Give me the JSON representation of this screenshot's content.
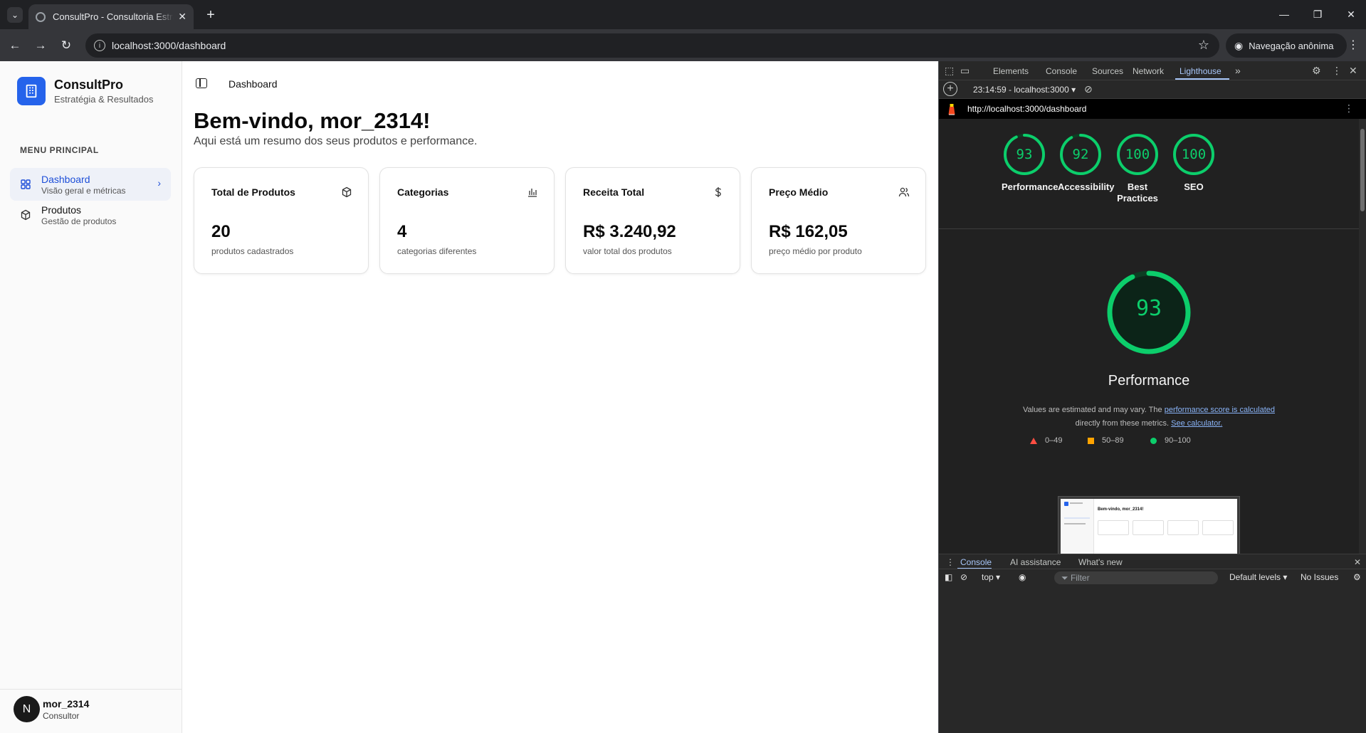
{
  "browser": {
    "tab_title": "ConsultPro - Consultoria Estratégica",
    "url": "localhost:3000/dashboard",
    "incognito_label": "Navegação anônima"
  },
  "sidebar": {
    "brand_name": "ConsultPro",
    "brand_subtitle": "Estratégia & Resultados",
    "menu_label": "MENU PRINCIPAL",
    "items": [
      {
        "title": "Dashboard",
        "subtitle": "Visão geral e métricas",
        "active": true
      },
      {
        "title": "Produtos",
        "subtitle": "Gestão de produtos",
        "active": false
      }
    ],
    "user": {
      "initial": "N",
      "name": "mor_2314",
      "role": "Consultor"
    }
  },
  "main": {
    "breadcrumb": "Dashboard",
    "welcome_title": "Bem-vindo, mor_2314!",
    "welcome_subtitle": "Aqui está um resumo dos seus produtos e performance.",
    "cards": [
      {
        "title": "Total de Produtos",
        "value": "20",
        "caption": "produtos cadastrados",
        "icon": "package-icon"
      },
      {
        "title": "Categorias",
        "value": "4",
        "caption": "categorias diferentes",
        "icon": "bar-chart-icon"
      },
      {
        "title": "Receita Total",
        "value": "R$ 3.240,92",
        "caption": "valor total dos produtos",
        "icon": "dollar-icon"
      },
      {
        "title": "Preço Médio",
        "value": "R$ 162,05",
        "caption": "preço médio por produto",
        "icon": "users-icon"
      }
    ]
  },
  "devtools": {
    "tabs": [
      "Elements",
      "Console",
      "Sources",
      "Network",
      "Lighthouse"
    ],
    "active_tab": "Lighthouse",
    "report_selector": "23:14:59 - localhost:3000",
    "report_url": "http://localhost:3000/dashboard",
    "scores": [
      {
        "label": "Performance",
        "score": 93
      },
      {
        "label": "Accessibility",
        "score": 92
      },
      {
        "label": "Best Practices",
        "score": 100
      },
      {
        "label": "SEO",
        "score": 100
      }
    ],
    "performance": {
      "score": 93,
      "title": "Performance",
      "note_prefix": "Values are estimated and may vary. The ",
      "note_link1": "performance score is calculated",
      "note_middle": " directly from these metrics. ",
      "note_link2": "See calculator."
    },
    "legend": [
      "0–49",
      "50–89",
      "90–100"
    ],
    "legend_colors": {
      "fail": "#ff4e42",
      "average": "#ffa400",
      "pass": "#0cce6b"
    },
    "thumbnail_title": "Bem-vindo, mor_2314!",
    "drawer_tabs": [
      "Console",
      "AI assistance",
      "What's new"
    ],
    "console": {
      "context": "top",
      "filter_placeholder": "Filter",
      "levels": "Default levels",
      "issues": "No Issues"
    }
  }
}
